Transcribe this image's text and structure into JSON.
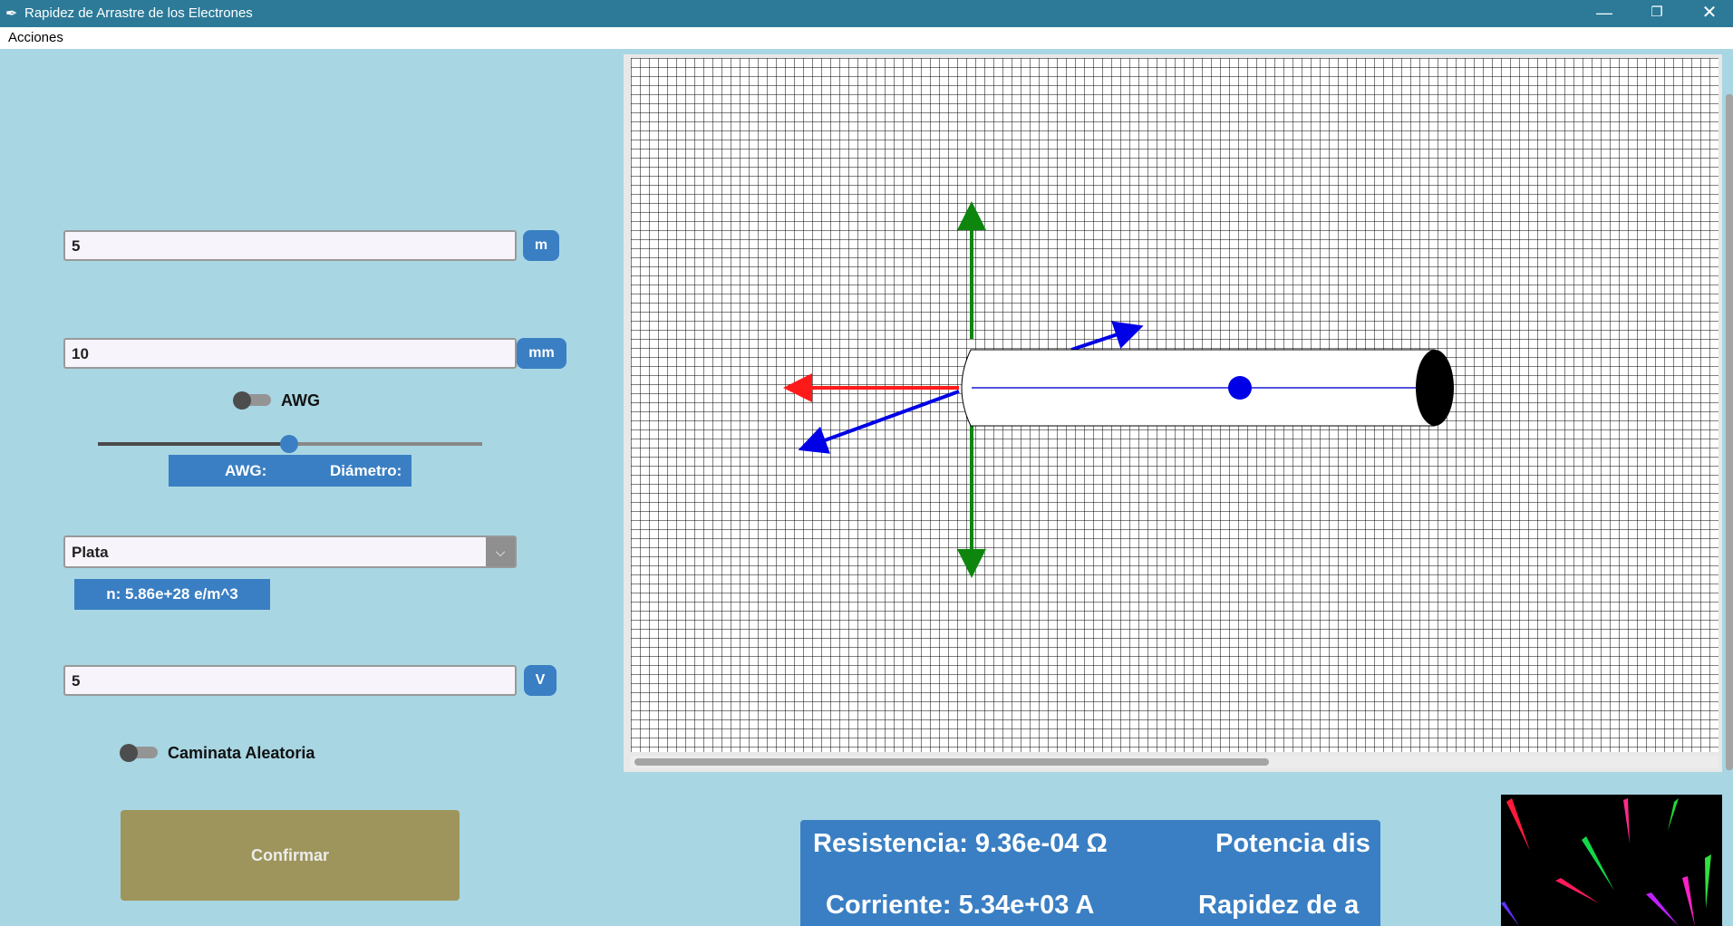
{
  "window": {
    "title": "Rapidez de Arrastre de los Electrones",
    "icon": "feather-icon",
    "title_color": "#2c7a98"
  },
  "menu": {
    "acciones": "Acciones"
  },
  "length": {
    "value": "5",
    "unit": "m"
  },
  "diameter": {
    "value": "10",
    "unit": "mm"
  },
  "awg_toggle": {
    "label": "AWG",
    "on": false
  },
  "awg_slider": {
    "position": 0.5
  },
  "awg_info": {
    "awg_label": "AWG:",
    "diametro_label": "Diámetro:"
  },
  "material": {
    "selected": "Plata",
    "density": "n: 5.86e+28 e/m^3"
  },
  "voltage": {
    "value": "5",
    "unit": "V"
  },
  "random_walk": {
    "label": "Caminata Aleatoria",
    "on": false
  },
  "confirm": {
    "label": "Confirmar"
  },
  "results": {
    "resistencia": "Resistencia: 9.36e-04 Ω",
    "potencia": "Potencia dis",
    "corriente": "Corriente: 5.34e+03 A",
    "rapidez": "Rapidez de a"
  },
  "colors": {
    "accent": "#3a7fc3",
    "background": "#a8d6e3",
    "confirm": "#9e955c",
    "axis_y": "#0e860e",
    "axis_x": "#ff1a1a",
    "axis_z": "#0000e6"
  }
}
